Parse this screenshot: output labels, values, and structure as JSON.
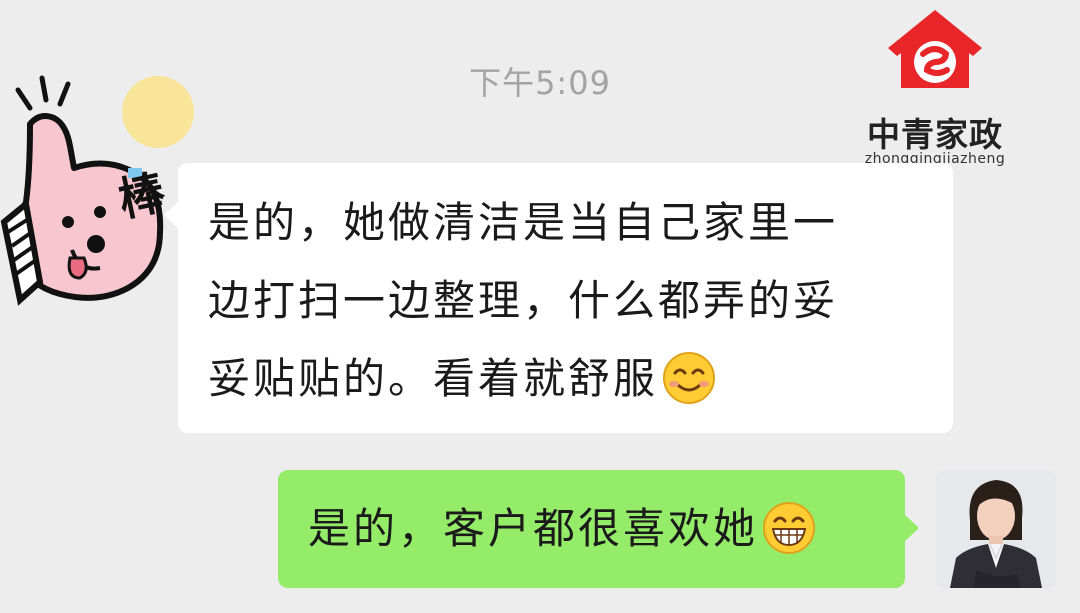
{
  "chat": {
    "timestamp": "下午5:09",
    "incoming": {
      "lines": [
        "是的，她做清洁是当自己家里一",
        "边打扫一边整理，什么都弄的妥",
        "妥贴贴的。看着就舒服"
      ],
      "emoji": "smiling-face-icon"
    },
    "outgoing": {
      "text": "是的，客户都很喜欢她",
      "emoji": "grinning-face-icon"
    }
  },
  "logo": {
    "name": "中青家政",
    "pinyin": "zhongqingjiazheng",
    "color": "#e8262a"
  },
  "sticker": {
    "text": "棒"
  },
  "colors": {
    "background": "#ededed",
    "incoming_bubble": "#ffffff",
    "outgoing_bubble": "#95ec69"
  }
}
